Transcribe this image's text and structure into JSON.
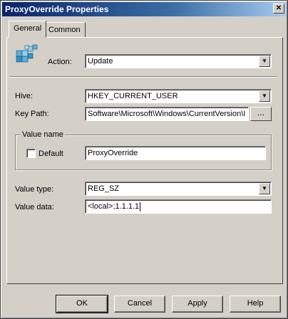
{
  "window": {
    "title": "ProxyOverride Properties",
    "close_glyph": "✕"
  },
  "tabs": [
    {
      "label": "General",
      "active": true
    },
    {
      "label": "Common",
      "active": false
    }
  ],
  "general": {
    "icon": "registry-cubes-icon",
    "action_label": "Action:",
    "action_value": "Update",
    "hive_label": "Hive:",
    "hive_value": "HKEY_CURRENT_USER",
    "key_path_label": "Key Path:",
    "key_path_value": "Software\\Microsoft\\Windows\\CurrentVersion\\I",
    "browse_label": "...",
    "value_name_group": "Value name",
    "default_label": "Default",
    "default_checked": false,
    "value_name_value": "ProxyOverride",
    "value_type_label": "Value type:",
    "value_type_value": "REG_SZ",
    "value_data_label": "Value data:",
    "value_data_value": "<local>;1.1.1.1"
  },
  "buttons": {
    "ok": "OK",
    "cancel": "Cancel",
    "apply": "Apply",
    "help": "Help"
  },
  "colors": {
    "face": "#d4d0c8",
    "title_start": "#0a246a",
    "title_end": "#a6caf0"
  }
}
